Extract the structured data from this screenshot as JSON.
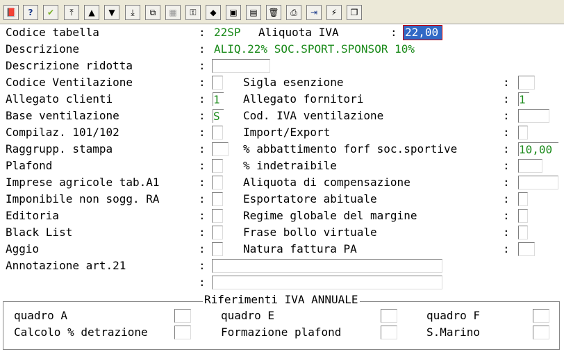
{
  "toolbar": {
    "buttons": [
      {
        "name": "book-icon",
        "glyph": "📕"
      },
      {
        "name": "help-icon",
        "glyph": "?"
      },
      {
        "name": "checkmark-icon",
        "glyph": "✔"
      },
      {
        "name": "first-record-icon",
        "glyph": "⤒"
      },
      {
        "name": "previous-record-icon",
        "glyph": "▲"
      },
      {
        "name": "next-record-icon",
        "glyph": "▼"
      },
      {
        "name": "last-record-icon",
        "glyph": "⤓"
      },
      {
        "name": "copy-icon",
        "glyph": "⧉"
      },
      {
        "name": "grid-icon",
        "glyph": "▦"
      },
      {
        "name": "key-icon",
        "glyph": "⚿"
      },
      {
        "name": "gem-icon",
        "glyph": "◆"
      },
      {
        "name": "save-icon",
        "glyph": "▣"
      },
      {
        "name": "document-icon",
        "glyph": "▤"
      },
      {
        "name": "trash-icon",
        "glyph": "🗑"
      },
      {
        "name": "printer-icon",
        "glyph": "⎙"
      },
      {
        "name": "exit-icon",
        "glyph": "⇥"
      },
      {
        "name": "lightning-icon",
        "glyph": "⚡"
      },
      {
        "name": "windows-icon",
        "glyph": "❐"
      }
    ]
  },
  "form": {
    "codice_tabella": {
      "label": "Codice tabella",
      "value": "22SP"
    },
    "aliquota_iva": {
      "label": "Aliquota IVA",
      "value": "22,00"
    },
    "descrizione": {
      "label": "Descrizione",
      "value": "ALIQ.22% SOC.SPORT.SPONSOR 10%"
    },
    "descrizione_ridotta": {
      "label": "Descrizione ridotta",
      "value": ""
    },
    "codice_ventilazione": {
      "label": "Codice Ventilazione",
      "value": ""
    },
    "sigla_esenzione": {
      "label": "Sigla esenzione",
      "value": ""
    },
    "allegato_clienti": {
      "label": "Allegato clienti",
      "value": "1"
    },
    "allegato_fornitori": {
      "label": "Allegato fornitori",
      "value": "1"
    },
    "base_ventilazione": {
      "label": "Base ventilazione",
      "value": "S"
    },
    "cod_iva_ventilazione": {
      "label": "Cod. IVA ventilazione",
      "value": ""
    },
    "compilaz_101_102": {
      "label": "Compilaz. 101/102",
      "value": ""
    },
    "import_export": {
      "label": "Import/Export",
      "value": ""
    },
    "raggrupp_stampa": {
      "label": "Raggrupp. stampa",
      "value": ""
    },
    "abbattimento_forf": {
      "label": "% abbattimento forf soc.sportive",
      "value": "10,00"
    },
    "plafond": {
      "label": "Plafond",
      "value": ""
    },
    "indetraibile": {
      "label": "% indetraibile",
      "value": ""
    },
    "imprese_agricole": {
      "label": "Imprese agricole tab.A1",
      "value": ""
    },
    "aliquota_compensazione": {
      "label": "Aliquota di compensazione",
      "value": ""
    },
    "imponibile_non_sogg": {
      "label": "Imponibile non sogg. RA",
      "value": ""
    },
    "esportatore_abituale": {
      "label": "Esportatore abituale",
      "value": ""
    },
    "editoria": {
      "label": "Editoria",
      "value": ""
    },
    "regime_globale_margine": {
      "label": "Regime globale del margine",
      "value": ""
    },
    "black_list": {
      "label": "Black List",
      "value": ""
    },
    "frase_bollo_virtuale": {
      "label": "Frase bollo virtuale",
      "value": ""
    },
    "aggio": {
      "label": "Aggio",
      "value": ""
    },
    "natura_fattura_pa": {
      "label": "Natura fattura PA",
      "value": ""
    },
    "annotazione_art21": {
      "label": "Annotazione art.21",
      "value": "",
      "value2": ""
    }
  },
  "colon": ":",
  "riferimenti": {
    "title": "Riferimenti IVA ANNUALE",
    "quadro_a": "quadro A",
    "quadro_e": "quadro E",
    "quadro_f": "quadro F",
    "calcolo_detrazione": "Calcolo % detrazione",
    "formazione_plafond": "Formazione plafond",
    "s_marino": "S.Marino"
  },
  "colors": {
    "accent_selection": "#3169c6",
    "value_text": "#1a8a1a",
    "focus_border": "#d00000"
  }
}
